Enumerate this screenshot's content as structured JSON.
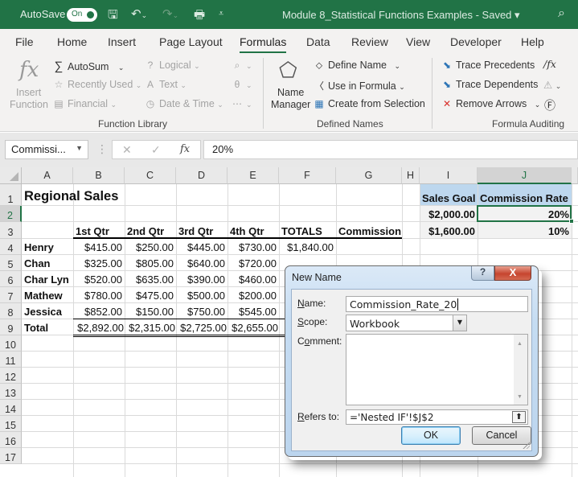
{
  "titlebar": {
    "autosave_label": "AutoSave",
    "autosave_state": "On",
    "document_title": "Module 8_Statistical Functions Examples  -  Saved  ▾",
    "icons": [
      "save-icon",
      "undo-icon",
      "redo-icon",
      "print-preview-icon",
      "customize-toolbar-icon",
      "search-icon"
    ]
  },
  "menu": {
    "tabs": [
      {
        "label": "File"
      },
      {
        "label": "Home"
      },
      {
        "label": "Insert"
      },
      {
        "label": "Page Layout"
      },
      {
        "label": "Formulas",
        "active": true
      },
      {
        "label": "Data"
      },
      {
        "label": "Review"
      },
      {
        "label": "View"
      },
      {
        "label": "Developer"
      },
      {
        "label": "Help"
      }
    ]
  },
  "ribbon": {
    "function_library": {
      "group_label": "Function Library",
      "insert_function_line1": "Insert",
      "insert_function_line2": "Function",
      "autosum": "AutoSum",
      "recently_used": "Recently Used",
      "financial": "Financial",
      "logical": "Logical",
      "text": "Text",
      "date_time": "Date & Time"
    },
    "defined_names": {
      "group_label": "Defined Names",
      "name_manager_line1": "Name",
      "name_manager_line2": "Manager",
      "define_name": "Define Name",
      "use_in_formula": "Use in Formula",
      "create_from_selection": "Create from Selection"
    },
    "formula_auditing": {
      "group_label": "Formula Auditing",
      "trace_precedents": "Trace Precedents",
      "trace_dependents": "Trace Dependents",
      "remove_arrows": "Remove Arrows"
    }
  },
  "formula_bar": {
    "name_box": "Commissi...",
    "cancel_glyph": "✕",
    "enter_glyph": "✓",
    "fx_glyph": "fx",
    "formula": "20%"
  },
  "sheet": {
    "columns": [
      "A",
      "B",
      "C",
      "D",
      "E",
      "F",
      "G",
      "H",
      "I",
      "J"
    ],
    "rows": [
      "1",
      "2",
      "3",
      "4",
      "5",
      "6",
      "7",
      "8",
      "9",
      "10",
      "11",
      "12",
      "13",
      "14",
      "15",
      "16",
      "17"
    ],
    "selected_column": "J",
    "selected_row": "2",
    "title": "Regional Sales",
    "headers": [
      "1st Qtr",
      "2nd Qtr",
      "3rd Qtr",
      "4th Qtr",
      "TOTALS",
      "Commission"
    ],
    "data_rows": [
      {
        "name": "Henry",
        "values": [
          "$415.00",
          "$250.00",
          "$445.00",
          "$730.00"
        ],
        "total": "$1,840.00"
      },
      {
        "name": "Chan",
        "values": [
          "$325.00",
          "$805.00",
          "$640.00",
          "$720.00"
        ]
      },
      {
        "name": "Char Lyn",
        "values": [
          "$520.00",
          "$635.00",
          "$390.00",
          "$460.00"
        ]
      },
      {
        "name": "Mathew",
        "values": [
          "$780.00",
          "$475.00",
          "$500.00",
          "$200.00"
        ]
      },
      {
        "name": "Jessica",
        "values": [
          "$852.00",
          "$150.00",
          "$750.00",
          "$545.00"
        ]
      }
    ],
    "total_row": {
      "label": "Total",
      "values": [
        "$2,892.00",
        "$2,315.00",
        "$2,725.00",
        "$2,655.00"
      ]
    },
    "side_table": {
      "headers": [
        "Sales Goal",
        "Commission Rate"
      ],
      "rows": [
        {
          "goal": "$2,000.00",
          "rate": "20%"
        },
        {
          "goal": "$1,600.00",
          "rate": "10%"
        }
      ]
    }
  },
  "dialog": {
    "title": "New Name",
    "help_glyph": "?",
    "close_glyph": "X",
    "name_label_ul": "N",
    "name_label_rest": "ame:",
    "name_value": "Commission_Rate_20",
    "scope_label_ul": "S",
    "scope_label_rest": "cope:",
    "scope_value": "Workbook",
    "comment_label_pre": "C",
    "comment_label_ul": "o",
    "comment_label_rest": "mment:",
    "comment_value": "",
    "refers_label_ul": "R",
    "refers_label_rest": "efers to:",
    "refers_value": "='Nested IF'!$J$2",
    "ok_label": "OK",
    "cancel_label": "Cancel"
  }
}
